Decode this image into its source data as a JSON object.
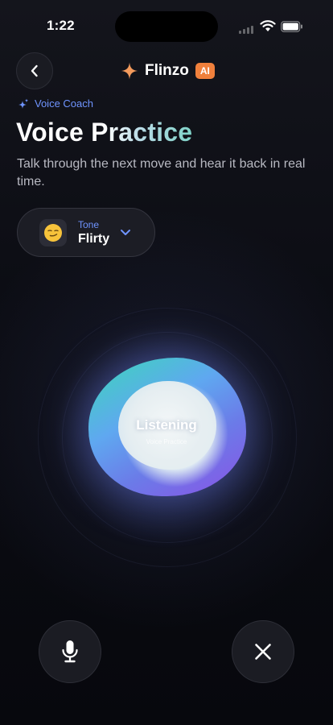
{
  "status_bar": {
    "time": "1:22"
  },
  "header": {
    "back_icon": "chevron-left-icon",
    "brand_icon": "sparkle-icon",
    "brand_name": "Flinzo",
    "badge": "AI"
  },
  "eyebrow": {
    "icon": "sparkles-icon",
    "label": "Voice Coach"
  },
  "title": "Voice Practice",
  "subtitle": "Talk through the next move and hear it back in real time.",
  "tone": {
    "label": "Tone",
    "value": "Flirty",
    "emoji": "😏",
    "icon": "chevron-down-icon"
  },
  "orb": {
    "status": "Listening",
    "sublabel": "Voice Practice"
  },
  "controls": {
    "mic_icon": "microphone-icon",
    "close_icon": "close-icon"
  },
  "colors": {
    "accent_blue": "#6f94ff",
    "badge_orange": "#f0803c",
    "brand_star": "#f39a5c"
  }
}
